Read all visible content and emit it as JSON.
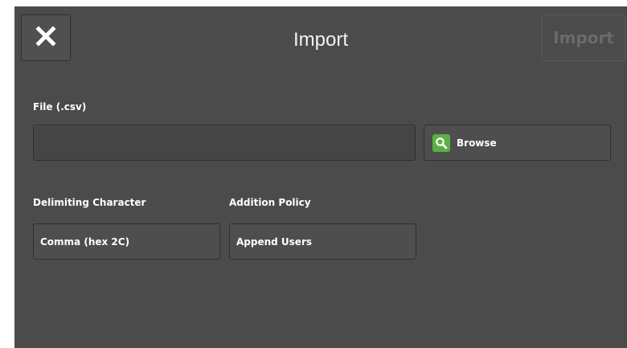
{
  "header": {
    "title": "Import",
    "close_icon": "close-icon",
    "import_label": "Import"
  },
  "file": {
    "label": "File (.csv)",
    "value": "",
    "browse_label": "Browse",
    "browse_icon": "search-icon",
    "browse_icon_color": "#5bb045"
  },
  "delimiter": {
    "label": "Delimiting Character",
    "value": "Comma (hex 2C)"
  },
  "policy": {
    "label": "Addition Policy",
    "value": "Append Users"
  }
}
